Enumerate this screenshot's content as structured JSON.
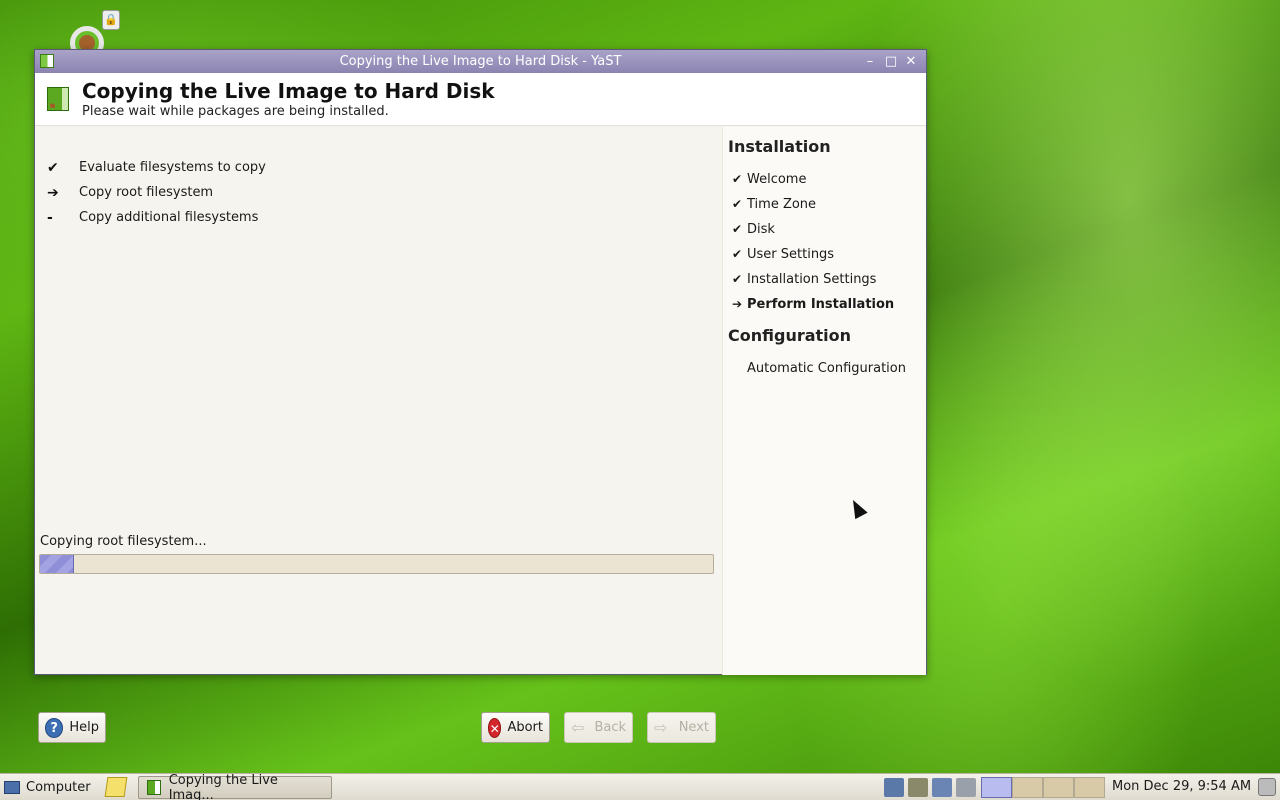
{
  "window": {
    "title": "Copying the Live Image to Hard Disk - YaST",
    "controls": {
      "minimize": "–",
      "maximize": "□",
      "close": "✕"
    }
  },
  "header": {
    "title": "Copying the Live Image to Hard Disk",
    "subtitle": "Please wait while packages are being installed."
  },
  "steps": [
    {
      "mark": "✔",
      "label": "Evaluate filesystems to copy",
      "state": "done"
    },
    {
      "mark": "➔",
      "label": "Copy root filesystem",
      "state": "current"
    },
    {
      "mark": "-",
      "label": "Copy additional filesystems",
      "state": "pending"
    }
  ],
  "progress": {
    "label": "Copying root filesystem...",
    "fraction": 0.05
  },
  "buttons": {
    "help": "Help",
    "abort": "Abort",
    "back": "Back",
    "next": "Next"
  },
  "sidebar": {
    "installation_heading": "Installation",
    "installation_items": [
      {
        "mark": "✔",
        "label": "Welcome"
      },
      {
        "mark": "✔",
        "label": "Time Zone"
      },
      {
        "mark": "✔",
        "label": "Disk"
      },
      {
        "mark": "✔",
        "label": "User Settings"
      },
      {
        "mark": "✔",
        "label": "Installation Settings"
      },
      {
        "mark": "➔",
        "label": "Perform Installation"
      }
    ],
    "configuration_heading": "Configuration",
    "configuration_items": [
      {
        "mark": "",
        "label": "Automatic Configuration"
      }
    ]
  },
  "taskbar": {
    "menu_label": "Computer",
    "task_label": "Copying the Live Imag...",
    "clock": "Mon Dec 29,  9:54 AM",
    "workspaces": 4,
    "active_workspace": 1
  },
  "colors": {
    "titlebar": "#9b95c0",
    "progress_fill": "#9a9ade",
    "desktop": "#5fb613"
  },
  "icons": {
    "window": "yast-icon",
    "help": "help-icon",
    "abort": "abort-icon",
    "back": "back-arrow-icon",
    "next": "next-arrow-icon"
  }
}
